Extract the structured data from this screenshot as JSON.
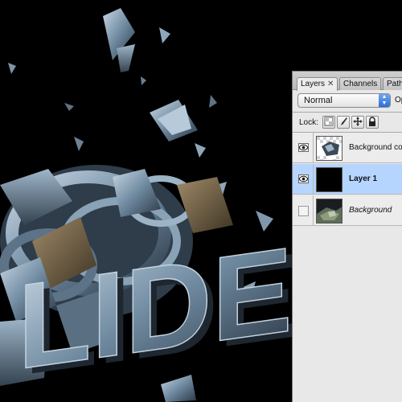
{
  "layers_panel": {
    "tabs": [
      {
        "label": "Layers",
        "close": "✕"
      },
      {
        "label": "Channels"
      },
      {
        "label": "Path"
      }
    ],
    "blend_mode": "Normal",
    "opacity_label": "Op",
    "lock_label": "Lock:",
    "lock_icons": [
      "transparency-lock-icon",
      "brush-icon",
      "move-icon",
      "padlock-icon"
    ],
    "layers": [
      {
        "name": "Background cop",
        "visible": true,
        "selected": false,
        "style": "normal",
        "thumbnail": "3d-text-thumbnail"
      },
      {
        "name": "Layer 1",
        "visible": true,
        "selected": true,
        "style": "bold",
        "thumbnail": "black-fill-thumbnail"
      },
      {
        "name": "Background",
        "visible": false,
        "selected": false,
        "style": "italic",
        "thumbnail": "background-image-thumbnail"
      }
    ],
    "selected_color": "#b5d5ff"
  },
  "canvas": {
    "background_color": "#000000",
    "text": "LIDE"
  }
}
